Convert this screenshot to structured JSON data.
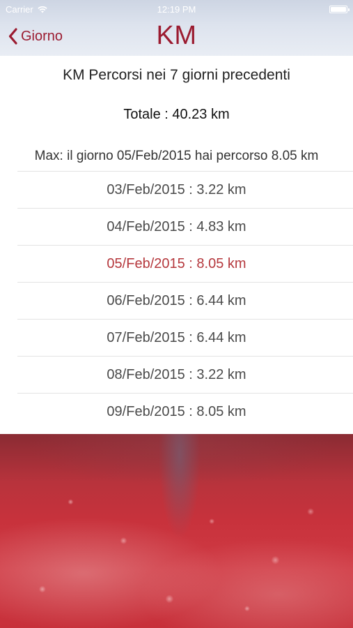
{
  "status_bar": {
    "carrier": "Carrier",
    "time": "12:19 PM",
    "wifi_icon": "wifi-icon",
    "battery_icon": "battery-icon"
  },
  "nav": {
    "back_label": "Giorno",
    "back_icon": "chevron-left-icon",
    "title": "KM",
    "accent_color": "#9b1b30"
  },
  "summary": {
    "heading": "KM Percorsi nei 7 giorni precedenti",
    "total": "Totale : 40.23 km",
    "max": "Max: il giorno 05/Feb/2015 hai percorso 8.05 km"
  },
  "days": [
    {
      "label": "03/Feb/2015 : 3.22 km",
      "highlight": false
    },
    {
      "label": "04/Feb/2015 : 4.83 km",
      "highlight": false
    },
    {
      "label": "05/Feb/2015 : 8.05 km",
      "highlight": true
    },
    {
      "label": "06/Feb/2015 : 6.44 km",
      "highlight": false
    },
    {
      "label": "07/Feb/2015 : 6.44 km",
      "highlight": false
    },
    {
      "label": "08/Feb/2015 : 3.22 km",
      "highlight": false
    },
    {
      "label": "09/Feb/2015 : 8.05 km",
      "highlight": false
    }
  ],
  "colors": {
    "highlight": "#b5383d",
    "nav_background": "#dde3ee"
  }
}
